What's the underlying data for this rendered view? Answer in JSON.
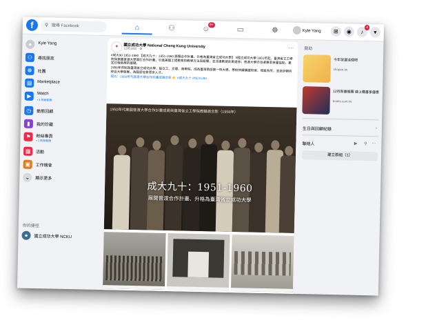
{
  "topbar": {
    "logo": "f",
    "search_icon": "search-icon",
    "search_placeholder": "搜尋 Facebook",
    "tabs": [
      {
        "name": "home-tab",
        "glyph": "⌂",
        "active": true,
        "badge": ""
      },
      {
        "name": "friends-tab",
        "glyph": "⚇",
        "active": false,
        "badge": ""
      },
      {
        "name": "watch-tab",
        "glyph": "☺",
        "active": false,
        "badge": "9+"
      },
      {
        "name": "marketplace-tab",
        "glyph": "▭",
        "active": false,
        "badge": ""
      },
      {
        "name": "groups-tab",
        "glyph": "☸",
        "active": false,
        "badge": ""
      }
    ],
    "profile_name": "Kyle Yang",
    "right_buttons": [
      {
        "name": "menu-grid-button",
        "glyph": "⊞",
        "badge": ""
      },
      {
        "name": "messenger-button",
        "glyph": "◉",
        "badge": ""
      },
      {
        "name": "notifications-button",
        "glyph": "♪",
        "badge": "4"
      },
      {
        "name": "account-menu-button",
        "glyph": "▾",
        "badge": ""
      }
    ]
  },
  "sidebar": {
    "items": [
      {
        "name": "sidebar-item-profile",
        "label": "Kyle Yang",
        "sub": "",
        "color": "#c9ccd1",
        "glyph": "●"
      },
      {
        "name": "sidebar-item-friends",
        "label": "尋找朋友",
        "sub": "",
        "color": "#1877f2",
        "glyph": "⚇"
      },
      {
        "name": "sidebar-item-groups",
        "label": "社團",
        "sub": "",
        "color": "#1877f2",
        "glyph": "☸"
      },
      {
        "name": "sidebar-item-marketplace",
        "label": "Marketplace",
        "sub": "",
        "color": "#1877f2",
        "glyph": "▤"
      },
      {
        "name": "sidebar-item-watch",
        "label": "Watch",
        "sub": "• 9 則新動態",
        "color": "#1877f2",
        "glyph": "▶"
      },
      {
        "name": "sidebar-item-memories",
        "label": "動態回顧",
        "sub": "",
        "color": "#1877f2",
        "glyph": "◷"
      },
      {
        "name": "sidebar-item-saved",
        "label": "我的珍藏",
        "sub": "",
        "color": "#8b3ed8",
        "glyph": "▮"
      },
      {
        "name": "sidebar-item-pages",
        "label": "粉絲專頁",
        "sub": "• 1 則新動態",
        "color": "#f02849",
        "glyph": "⚑"
      },
      {
        "name": "sidebar-item-events",
        "label": "活動",
        "sub": "",
        "color": "#f02849",
        "glyph": "▦"
      },
      {
        "name": "sidebar-item-jobs",
        "label": "工作機會",
        "sub": "",
        "color": "#e07a1f",
        "glyph": "▣"
      },
      {
        "name": "sidebar-item-see-more",
        "label": "顯示更多",
        "sub": "",
        "color": "#d8dadf",
        "glyph": "⌄"
      }
    ],
    "shortcuts_heading": "你的捷徑",
    "shortcut": {
      "label": "國立成功大學 NCKU",
      "color": "#3b6e8f"
    }
  },
  "post": {
    "page_name": "國立成功大學 National Cheng Kung University",
    "meta": "12月16日 · ⚙",
    "more": "···",
    "paragraphs": [
      "#成大90 1951-1960 【成大九十：1951-1960 展開合作計畫、升格為臺灣省立成功大學】 #國立成功大學 1951年起，臺灣省立工學院與美國普渡大學簽訂合作計畫，引進美國工程教育的教學方法與設備，並派遣教授赴美進修；普渡大學亦派遣專家來臺協助，奠定日後發展的基礎。",
      "1956年改制為臺灣省立成功大學，設立工、文理、商學院，成為臺灣南部第一所大學。學校持續擴建校舍、增設系所，並逐步朝向綜合大學發展，為國家培育眾多人才。",
      "照片：1950年代普渡大學合作計畫成員合影 👉 #成大九十 #NCKU90"
    ],
    "photo_caption": "1950年代美國普渡大學合作計畫成員與臺灣省立工學院教職員合影（1958年）",
    "photo_title": "成大九十：1951-1960",
    "photo_subtitle": "展開普渡合作計畫、升格為臺灣省立成功大學"
  },
  "right": {
    "sponsored_heading": "贊助",
    "ads": [
      {
        "title": "今年就選這個吧",
        "desc": "shopee.tw",
        "color": "#f0b14a"
      },
      {
        "title": "12月新書推薦 線上購書享優惠",
        "desc": "books.com.tw",
        "color": "#1f2f5a"
      }
    ],
    "birthdays": "生日與回顧紀錄",
    "contacts_heading": "聯絡人",
    "contacts_icons": [
      "video-call-icon",
      "search-icon",
      "more-icon"
    ],
    "contacts_button": "建立群組（1）"
  }
}
